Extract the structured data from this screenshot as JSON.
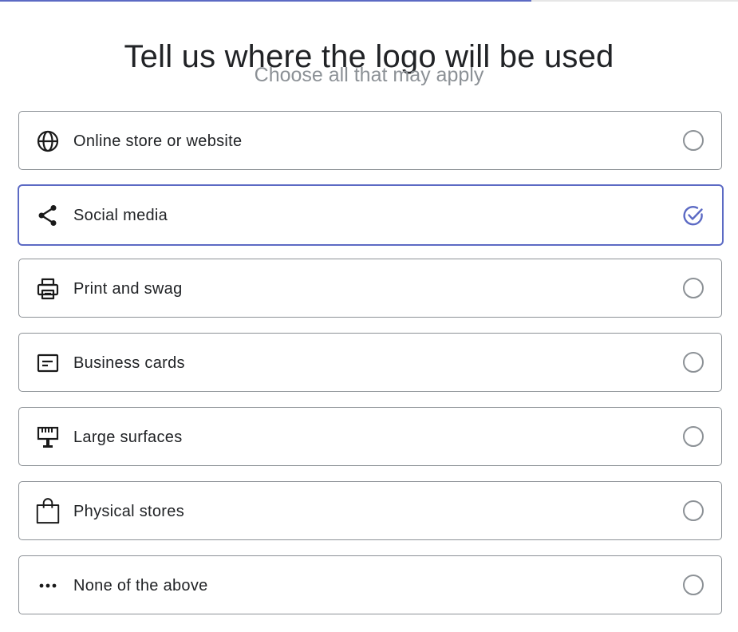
{
  "progress": {
    "fraction": 0.72,
    "fill_color": "#5c6ac4"
  },
  "header": {
    "title": "Tell us where the logo will be used",
    "subtitle": "Choose all that may apply"
  },
  "accent_color": "#5c6ac4",
  "options": [
    {
      "label": "Online store or website",
      "icon": "globe-icon",
      "selected": false
    },
    {
      "label": "Social media",
      "icon": "share-icon",
      "selected": true
    },
    {
      "label": "Print and swag",
      "icon": "printer-icon",
      "selected": false
    },
    {
      "label": "Business cards",
      "icon": "business-card-icon",
      "selected": false
    },
    {
      "label": "Large surfaces",
      "icon": "billboard-icon",
      "selected": false
    },
    {
      "label": "Physical stores",
      "icon": "shopping-bag-icon",
      "selected": false
    },
    {
      "label": "None of the above",
      "icon": "more-horizontal-icon",
      "selected": false
    }
  ]
}
